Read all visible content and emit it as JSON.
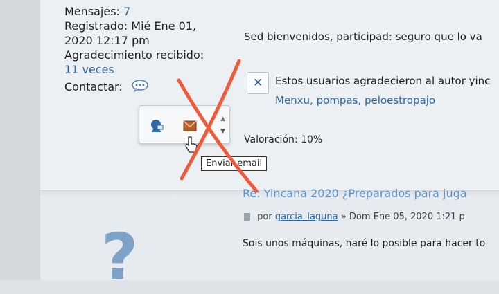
{
  "profile": {
    "messages_label": "Mensajes:",
    "messages_value": "7",
    "registered_label": "Registrado:",
    "registered_value_line1": "Mié Ene 01,",
    "registered_value_line2": "2020 12:17 pm",
    "thanks_received_label": "Agradecimiento recibido:",
    "thanks_received_value": "11 veces",
    "contact_label": "Contactar:"
  },
  "post": {
    "welcome_text": "Sed bienvenidos, participad: seguro que lo va",
    "thanks_users_text": "Estos usuarios agradecieron al autor yinc",
    "thanks_users": [
      "Menxu,",
      "pompas,",
      "peloestropajo"
    ],
    "rating": "Valoración: 10%"
  },
  "tooltip": {
    "send_email": "Enviar email"
  },
  "reply": {
    "title": "Re: Yincana 2020 ¿Preparados para juga",
    "by_label": "por",
    "author": "garcia_laguna",
    "date": "» Dom Ene 05, 2020 1:21 p",
    "body": "Sois unos máquinas, haré lo posible para hacer to"
  },
  "colors": {
    "link_blue": "#2a67a3",
    "title_blue": "#5b8fc8",
    "annotation_red": "#f05a3a"
  }
}
